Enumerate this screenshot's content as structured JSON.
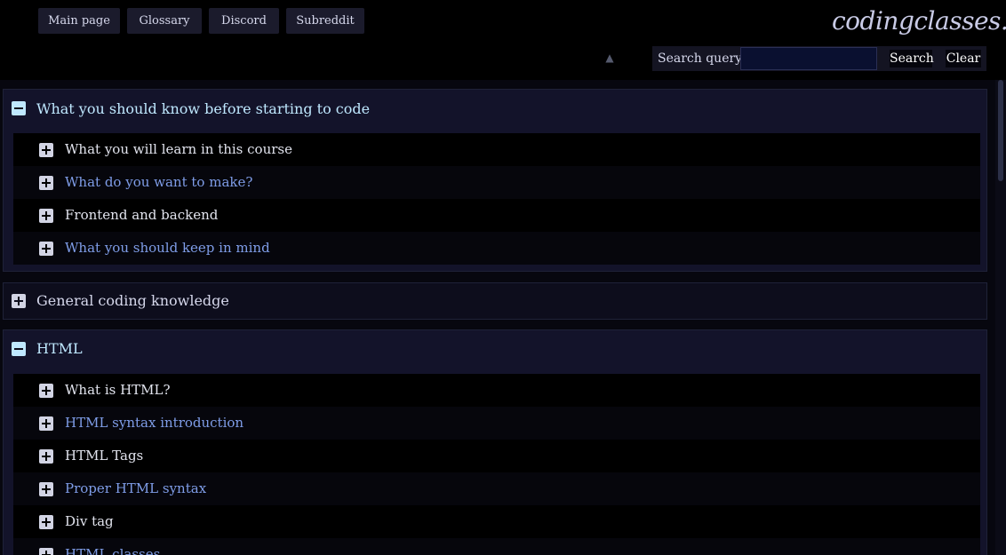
{
  "nav": {
    "buttons": [
      "Main page",
      "Glossary",
      "Discord",
      "Subreddit"
    ]
  },
  "brand": "codingclasses.cc",
  "search": {
    "label": "Search query:",
    "value": "",
    "placeholder": "",
    "search_label": "Search",
    "clear_label": "Clear"
  },
  "icons": {
    "collapse": "minus-square-icon",
    "expand": "plus-square-icon",
    "scroll_up": "caret-up-icon"
  },
  "colors": {
    "background": "#000000",
    "section_title": "#bfe8ff",
    "collapsed_title": "#d6d8ec",
    "minus_icon": "#bfe8ff",
    "link": "#7f9de8",
    "nav_button": "#1b1b2c"
  },
  "sections": [
    {
      "title": "What you should know before starting to code",
      "expanded": true,
      "items": [
        "What you will learn in this course",
        "What do you want to make?",
        "Frontend and backend",
        "What you should keep in mind"
      ]
    },
    {
      "title": "General coding knowledge",
      "expanded": false,
      "items": []
    },
    {
      "title": "HTML",
      "expanded": true,
      "items": [
        "What is HTML?",
        "HTML syntax introduction",
        "HTML Tags",
        "Proper HTML syntax",
        "Div tag",
        "HTML classes"
      ]
    }
  ]
}
